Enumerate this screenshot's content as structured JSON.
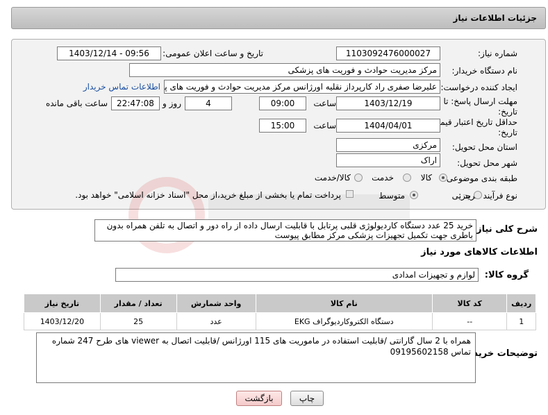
{
  "header": {
    "title": "جزئیات اطلاعات نیاز"
  },
  "fields": {
    "need_number_label": "شماره نیاز:",
    "need_number": "1103092476000027",
    "announce_label": "تاریخ و ساعت اعلان عمومی:",
    "announce_value": "1403/12/14 - 09:56",
    "buyer_org_label": "نام دستگاه خریدار:",
    "buyer_org": "مرکز مدیریت حوادث و فوریت های پزشکی",
    "creator_label": "ایجاد کننده درخواست:",
    "creator": "علیرضا صفری راد کارپرداز نقلیه اورژانس مرکز مدیریت حوادث و فوریت های پزشک",
    "contact_link": "اطلاعات تماس خریدار",
    "deadline_label_1": "مهلت ارسال پاسخ: تا",
    "deadline_label_2": "تاریخ:",
    "deadline_date": "1403/12/19",
    "time_label": "ساعت",
    "deadline_time": "09:00",
    "days_value": "4",
    "days_label": "روز و",
    "remaining_time": "22:47:08",
    "remaining_label": "ساعت باقی مانده",
    "validity_label_1": "حداقل تاریخ اعتبار قیمت: تا",
    "validity_label_2": "تاریخ:",
    "validity_date": "1404/04/01",
    "validity_time": "15:00",
    "province_label": "استان محل تحویل:",
    "province": "مرکزی",
    "city_label": "شهر محل تحویل:",
    "city": "اراک",
    "category_label": "طبقه بندی موضوعی:",
    "category_options": [
      "کالا",
      "خدمت",
      "کالا/خدمت"
    ],
    "process_label": "نوع فرآیند خرید :",
    "process_options": [
      "جزیی",
      "متوسط"
    ],
    "payment_note": "پرداخت تمام یا بخشی از مبلغ خرید،از محل \"اسناد خزانه اسلامی\" خواهد بود."
  },
  "description": {
    "label": "شرح کلی نیاز:",
    "text": "خرید 25 عدد دستگاه کاردیولوژی قلبی پرتابل با قابلیت ارسال داده از راه دور و اتصال به تلفن همراه بدون باطری جهت تکمیل تجهیزات پزشکی مرکز مطابق پیوست"
  },
  "goods_section": {
    "title": "اطلاعات کالاهای مورد نیاز",
    "group_label": "گروه کالا:",
    "group_value": "لوازم و تجهیزات امدادی"
  },
  "table": {
    "headers": [
      "ردیف",
      "کد کالا",
      "نام کالا",
      "واحد شمارش",
      "تعداد / مقدار",
      "تاریخ نیاز"
    ],
    "rows": [
      [
        "1",
        "--",
        "دستگاه الکتروکاردیوگراف EKG",
        "عدد",
        "25",
        "1403/12/20"
      ]
    ]
  },
  "buyer_notes": {
    "label": "توضیحات خریدار:",
    "text": "همراه با 2 سال گارانتی /قابلیت استفاده در ماموریت های 115 اورژانس /قابلیت اتصال به viewer های طرح 247 شماره تماس 09195602158"
  },
  "buttons": {
    "print": "چاپ",
    "back": "بازگشت"
  },
  "colors": {
    "link": "#1a4fa0",
    "header_bg": "#c9c9c9",
    "back_button": "#f4caca"
  }
}
